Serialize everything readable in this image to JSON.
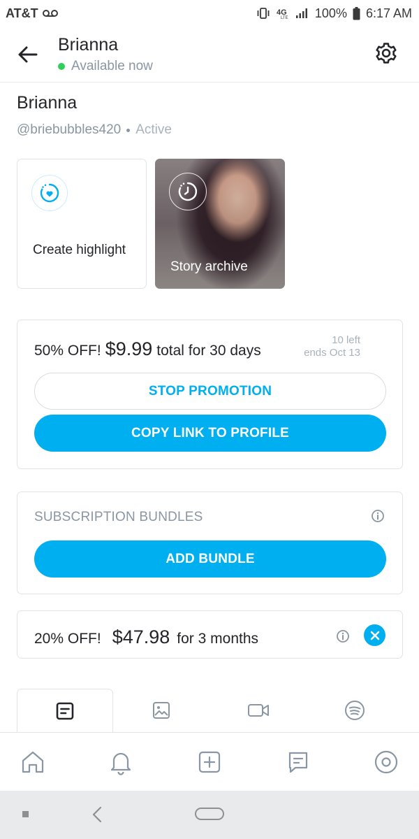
{
  "status_bar": {
    "carrier": "AT&T",
    "battery": "100%",
    "time": "6:17 AM"
  },
  "header": {
    "title": "Brianna",
    "status": "Available now"
  },
  "profile": {
    "name": "Brianna",
    "handle": "@briebubbles420",
    "activity": "Active"
  },
  "highlights": {
    "create_label": "Create highlight",
    "archive_label": "Story archive"
  },
  "promotion": {
    "discount": "50% OFF!",
    "price": "$9.99",
    "terms": "total for 30 days",
    "remaining": "10 left",
    "ends": "ends Oct 13",
    "stop_label": "STOP PROMOTION",
    "copy_label": "COPY LINK TO PROFILE"
  },
  "bundles": {
    "title": "SUBSCRIPTION BUNDLES",
    "add_label": "ADD BUNDLE",
    "items": [
      {
        "discount": "20% OFF!",
        "price": "$47.98",
        "terms": "for 3 months"
      }
    ]
  },
  "tabs": [
    "posts",
    "photos",
    "videos",
    "audio"
  ],
  "bottom_nav": [
    "home",
    "notifications",
    "add-post",
    "messages",
    "profile"
  ],
  "colors": {
    "accent": "#00aff0",
    "online": "#2fcf5a",
    "muted_text": "#8a96a3"
  }
}
